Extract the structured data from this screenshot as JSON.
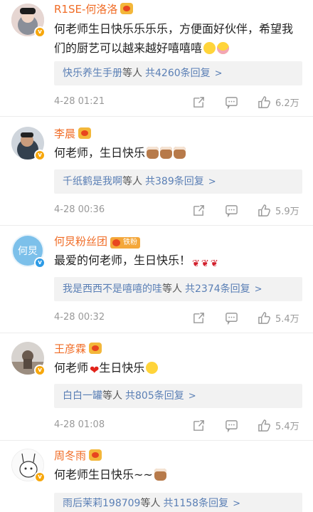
{
  "comments": [
    {
      "name": "R1SE-何洛洛",
      "badge": "crown",
      "text": "何老师生日快乐乐乐乐，方便面好伙伴，希望我们的厨艺可以越来越好嘻嘻嘻",
      "emojis": [
        "grin",
        "tongue"
      ],
      "reply_from": "快乐养生手册",
      "reply_suffix": "等人",
      "reply_total": "共4260条回复",
      "time": "4-28 01:21",
      "likes": "6.2万",
      "avatar_color": "#d9c7c4"
    },
    {
      "name": "李晨",
      "badge": "crown",
      "text": "何老师，生日快乐",
      "emojis": [
        "cake",
        "cake",
        "cake"
      ],
      "reply_from": "千纸鹤是我啊",
      "reply_suffix": "等人",
      "reply_total": "共389条回复",
      "time": "4-28 00:36",
      "likes": "5.9万",
      "avatar_color": "#5c6b7d"
    },
    {
      "name": "何炅粉丝团",
      "badge": "fan",
      "fan_label": "铁粉",
      "text": "最爱的何老师，生日快乐！",
      "emojis": [
        "rose",
        "rose",
        "rose"
      ],
      "reply_from": "我是西西不是嘻嘻的哇",
      "reply_suffix": "等人",
      "reply_total": "共2374条回复",
      "time": "4-28 00:32",
      "likes": "5.4万",
      "avatar_color": "#6fb6e6"
    },
    {
      "name": "王彦霖",
      "badge": "crown",
      "text_before": "何老师",
      "text_after": "生日快乐",
      "emojis": [
        "smile"
      ],
      "reply_from": "白白一罐",
      "reply_suffix": "等人",
      "reply_total": "共805条回复",
      "time": "4-28 01:08",
      "likes": "5.4万",
      "avatar_color": "#8e7f72"
    },
    {
      "name": "周冬雨",
      "badge": "crown",
      "text": "何老师生日快乐~~",
      "emojis": [
        "cake"
      ],
      "reply_from": "雨后茉莉198709",
      "reply_suffix": "等人",
      "reply_total": "共1158条回复",
      "avatar_color": "#f4f4f4"
    }
  ],
  "icons": {
    "verified": "v-badge-icon",
    "reply_chevron": "chevron-right-icon",
    "share": "share-icon",
    "comment": "comment-icon",
    "like": "like-icon"
  },
  "colors": {
    "name": "#f06c26",
    "link": "#5a7fb5",
    "meta": "#999999"
  }
}
